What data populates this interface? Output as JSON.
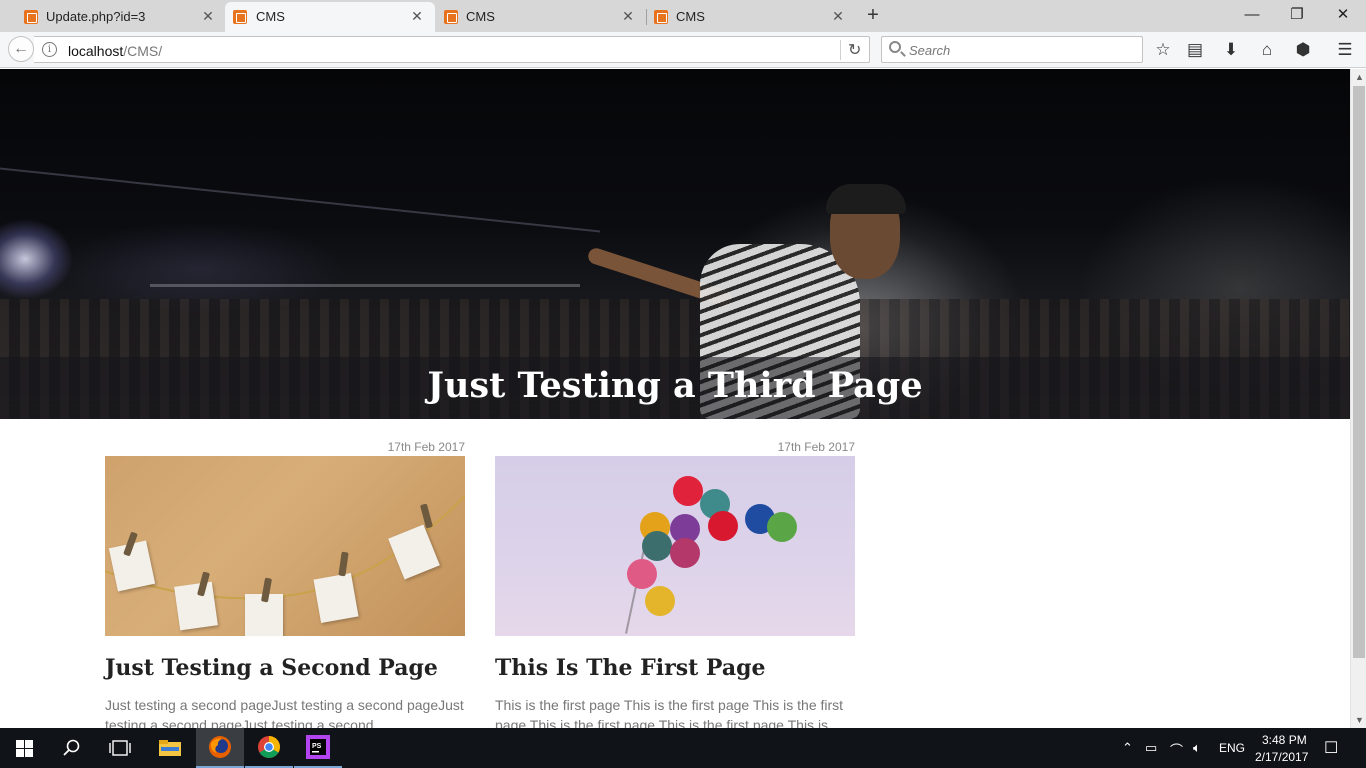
{
  "browser": {
    "tabs": [
      {
        "label": "Update.php?id=3",
        "active": false
      },
      {
        "label": "CMS",
        "active": true
      },
      {
        "label": "CMS",
        "active": false
      },
      {
        "label": "CMS",
        "active": false
      }
    ],
    "new_tab_glyph": "+",
    "window_controls": {
      "minimize": "—",
      "restore": "❐",
      "close": "✕"
    },
    "url": {
      "host": "localhost",
      "path": "/CMS/"
    },
    "search_placeholder": "Search",
    "toolbar_icons": [
      "bookmark-star-icon",
      "reading-list-icon",
      "download-icon",
      "home-icon",
      "pocket-icon",
      "menu-icon"
    ]
  },
  "page": {
    "hero": {
      "title": "Just Testing a Third Page"
    },
    "posts": [
      {
        "date": "17th Feb 2017",
        "title": "Just Testing a Second Page",
        "excerpt": "Just testing a second pageJust testing a second pageJust testing a second pageJust testing a second"
      },
      {
        "date": "17th Feb 2017",
        "title": "This Is The First Page",
        "excerpt": "This is the first page This is the first page This is the first page This is the first page This is the first page This is"
      }
    ]
  },
  "taskbar": {
    "apps": [
      "start-icon",
      "search-icon",
      "task-view-icon",
      "file-explorer-icon",
      "firefox-icon",
      "chrome-icon",
      "phpstorm-icon"
    ],
    "tray": {
      "language": "ENG",
      "time": "3:48 PM",
      "date": "2/17/2017"
    }
  },
  "colors": {
    "favicon": "#e8731f",
    "tabstrip": "#d7d7d7",
    "taskbar": "#101317",
    "accent": "#7aa7d8"
  }
}
